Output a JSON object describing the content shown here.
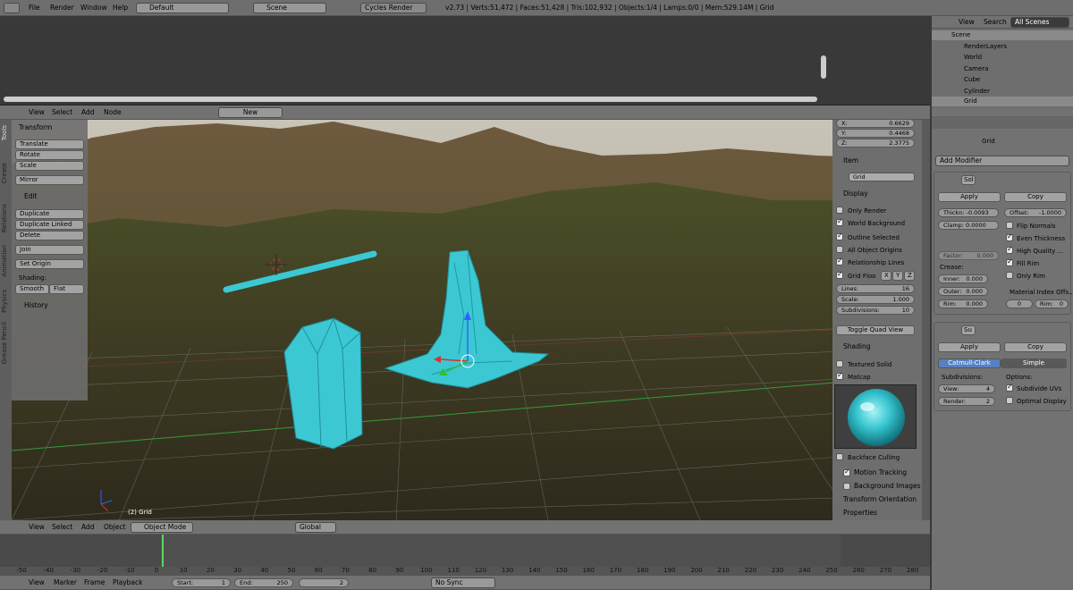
{
  "topbar": {
    "menus": [
      "File",
      "Render",
      "Window",
      "Help"
    ],
    "layout": "Default",
    "scene": "Scene",
    "engine": "Cycles Render",
    "stats": "v2.73 | Verts:51,472 | Faces:51,428 | Tris:102,932 | Objects:1/4 | Lamps:0/0 | Mem:529.14M | Grid"
  },
  "node_header": {
    "menus": [
      "View",
      "Select",
      "Add",
      "Node"
    ],
    "new_label": "New"
  },
  "tool_tabs": [
    "Tools",
    "Create",
    "Relations",
    "Animation",
    "Physics",
    "Grease Pencil"
  ],
  "toolshelf": {
    "transform_title": "Transform",
    "translate": "Translate",
    "rotate": "Rotate",
    "scale": "Scale",
    "mirror": "Mirror",
    "edit_title": "Edit",
    "duplicate": "Duplicate",
    "duplicate_linked": "Duplicate Linked",
    "delete": "Delete",
    "join": "Join",
    "set_origin": "Set Origin",
    "shading_label": "Shading:",
    "smooth": "Smooth",
    "flat": "Flat",
    "history_title": "History"
  },
  "viewport": {
    "object_label": "(2) Grid"
  },
  "properties_panel": {
    "x_label": "X:",
    "x_val": "0.6629",
    "y_label": "Y:",
    "y_val": "0.4468",
    "z_label": "Z:",
    "z_val": "2.3775",
    "item_title": "Item",
    "item_name": "Grid",
    "display_title": "Display",
    "only_render": "Only Render",
    "world_background": "World Background",
    "outline_selected": "Outline Selected",
    "all_object_origins": "All Object Origins",
    "relationship_lines": "Relationship Lines",
    "grid_floor": "Grid Floo",
    "axis_x": "X",
    "axis_y": "Y",
    "axis_z": "Z",
    "lines_label": "Lines:",
    "lines_val": "16",
    "scale_label": "Scale:",
    "scale_val": "1.000",
    "subdiv_label": "Subdivisions:",
    "subdiv_val": "10",
    "toggle_quad": "Toggle Quad View",
    "shading_title": "Shading",
    "textured_solid": "Textured Solid",
    "matcap": "Matcap",
    "backface_culling": "Backface Culling",
    "motion_tracking": "Motion Tracking",
    "background_images": "Background Images",
    "transform_orientation": "Transform Orientation",
    "properties": "Properties"
  },
  "view3d_header": {
    "menus": [
      "View",
      "Select",
      "Add",
      "Object"
    ],
    "mode": "Object Mode",
    "orientation": "Global"
  },
  "timeline": {
    "ticks": [
      "-50",
      "-40",
      "-30",
      "-20",
      "-10",
      "0",
      "10",
      "20",
      "30",
      "40",
      "50",
      "60",
      "70",
      "80",
      "90",
      "100",
      "110",
      "120",
      "130",
      "140",
      "150",
      "160",
      "170",
      "180",
      "190",
      "200",
      "210",
      "220",
      "230",
      "240",
      "250",
      "260",
      "270",
      "280"
    ],
    "menus": [
      "View",
      "Marker",
      "Frame",
      "Playback"
    ],
    "start_label": "Start:",
    "start_val": "1",
    "end_label": "End:",
    "end_val": "250",
    "current": "2",
    "sync": "No Sync"
  },
  "outliner": {
    "menus": [
      "View",
      "Search"
    ],
    "filter": "All Scenes",
    "items": [
      "Scene",
      "RenderLayers",
      "World",
      "Camera",
      "Cube",
      "Cylinder",
      "Grid"
    ]
  },
  "modifiers": {
    "object_name": "Grid",
    "add_modifier": "Add Modifier",
    "solidify": {
      "name": "Sol",
      "apply": "Apply",
      "copy": "Copy",
      "thickness": "Thickn: -0.0093",
      "offset": "Offset:",
      "offset_val": "-1.0000",
      "clamp": "Clamp: 0.0000",
      "flip_normals": "Flip Normals",
      "even_thickness": "Even Thickness",
      "high_quality": "High Quality ...",
      "factor": "Factor:",
      "factor_val": "0.000",
      "fill_rim": "Fill Rim",
      "only_rim": "Only Rim",
      "crease": "Crease:",
      "inner": "Inner:",
      "inner_val": "0.000",
      "outer": "Outer:",
      "outer_val": "0.000",
      "rim": "Rim:",
      "rim_val": "0.000",
      "material_index": "Material Index Offs...",
      "mat_val": "0",
      "rim2": "Rim:",
      "rim2_val": "0"
    },
    "subsurf": {
      "name": "Su",
      "apply": "Apply",
      "copy": "Copy",
      "catmull": "Catmull-Clark",
      "simple": "Simple",
      "subdivisions": "Subdivisions:",
      "options": "Options:",
      "view": "View:",
      "view_val": "4",
      "render": "Render:",
      "render_val": "2",
      "subdivide_uvs": "Subdivide UVs",
      "optimal_display": "Optimal Display"
    }
  },
  "colors": {
    "accent": "#5680c2",
    "object": "#3cc8d2"
  }
}
